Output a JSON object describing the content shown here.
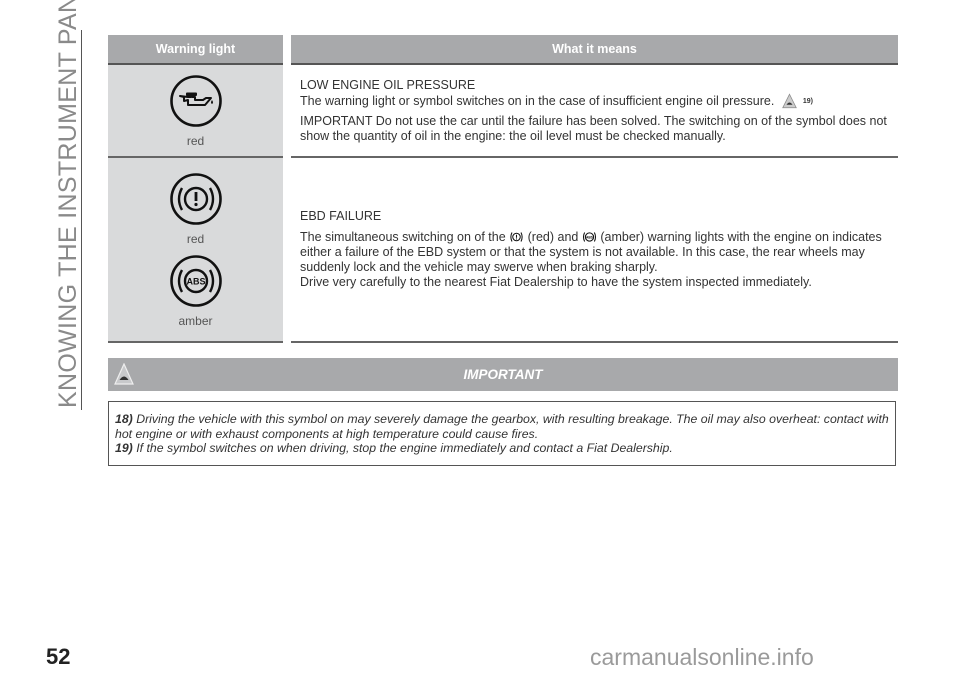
{
  "side_title": "KNOWING THE INSTRUMENT PANEL",
  "page_number": "52",
  "watermark": "carmanualsonline.info",
  "table": {
    "headers": [
      "Warning light",
      "What it means"
    ],
    "rows": [
      {
        "lights": [
          {
            "icon": "oil-pressure-icon",
            "color_label": "red"
          }
        ],
        "title": "LOW ENGINE OIL PRESSURE",
        "text_before_icon": "The warning light or symbol switches on in the case of insufficient engine oil pressure.",
        "ref": "19)",
        "important": "IMPORTANT Do not use the car until the failure has been solved. The switching on of the symbol does not show the quantity of oil in the engine: the oil level must be checked manually."
      },
      {
        "lights": [
          {
            "icon": "brake-warning-icon",
            "color_label": "red"
          },
          {
            "icon": "abs-icon",
            "color_label": "amber"
          }
        ],
        "title": "EBD FAILURE",
        "text_part1": "The simultaneous switching on of the",
        "text_part2": "(red) and",
        "text_part3": "(amber) warning lights with the engine on indicates either a failure of the EBD system or that the system is not available. In this case, the rear wheels may suddenly lock and the vehicle may swerve when braking sharply.",
        "text_part4": "Drive very carefully to the nearest Fiat Dealership to have the system inspected immediately."
      }
    ]
  },
  "important_box": {
    "title": "IMPORTANT",
    "notes": [
      {
        "num": "18)",
        "text": "Driving the vehicle with this symbol on may severely damage the gearbox, with resulting breakage. The oil may also overheat: contact with hot engine or with exhaust components at high temperature could cause fires."
      },
      {
        "num": "19)",
        "text": "If the symbol switches on when driving, stop the engine immediately and contact a Fiat Dealership."
      }
    ]
  }
}
